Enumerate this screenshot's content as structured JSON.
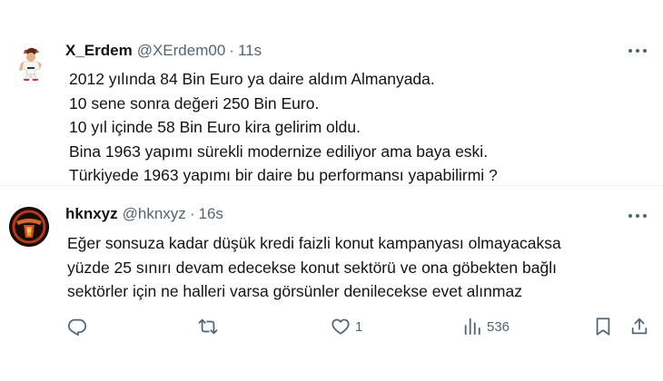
{
  "tweets": [
    {
      "display_name": "X_Erdem",
      "handle": "@XErdem00",
      "separator": "·",
      "time": "11s",
      "avatar": "character-avatar",
      "lines": [
        "2012 yılında 84 Bin Euro ya daire aldım Almanyada.",
        "10 sene sonra değeri 250 Bin Euro.",
        "10 yıl içinde 58 Bin Euro kira gelirim oldu.",
        "Bina 1963 yapımı sürekli modernize ediliyor ama baya eski.",
        "Türkiyede 1963 yapımı bir daire bu performansı yapabilirmi ?"
      ]
    },
    {
      "display_name": "hknxyz",
      "handle": "@hknxyz",
      "separator": "·",
      "time": "16s",
      "avatar": "emblem-avatar",
      "lines": [
        "Eğer sonsuza kadar düşük kredi faizli konut kampanyası olmayacaksa",
        "yüzde 25 sınırı devam edecekse konut sektörü ve ona göbekten bağlı",
        "sektörler için ne halleri varsa görsünler denilecekse evet alınmaz"
      ],
      "actions": {
        "reply_count": "",
        "retweet_count": "",
        "like_count": "1",
        "view_count": "536"
      }
    }
  ],
  "icons": {
    "reply": "reply-icon",
    "retweet": "retweet-icon",
    "like": "heart-icon",
    "views": "views-icon",
    "bookmark": "bookmark-icon",
    "share": "share-icon",
    "more": "more-icon"
  },
  "colors": {
    "text": "#0f1419",
    "secondary": "#536471",
    "divider": "#eff3f4"
  }
}
